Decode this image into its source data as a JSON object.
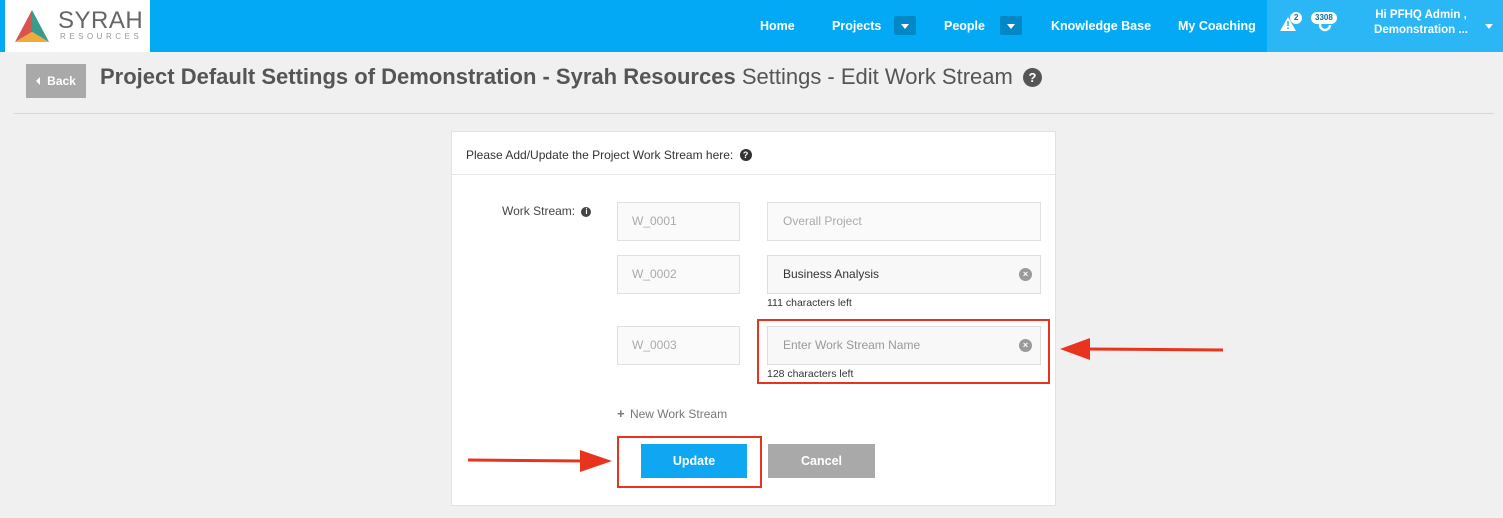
{
  "brand": {
    "name": "SYRAH",
    "sub": "RESOURCES"
  },
  "nav": {
    "home": "Home",
    "projects": "Projects",
    "people": "People",
    "knowledge_base": "Knowledge Base",
    "my_coaching": "My Coaching"
  },
  "notifications": {
    "alerts_count": "2",
    "updates_count": "3308"
  },
  "user": {
    "greeting": "Hi PFHQ Admin ,",
    "org": "Demonstration ..."
  },
  "header": {
    "back_label": "Back",
    "title_bold": "Project Default Settings of Demonstration - Syrah Resources",
    "title_rest": "Settings - Edit Work Stream",
    "help_glyph": "?"
  },
  "form": {
    "heading": "Please Add/Update the Project Work Stream here:",
    "help_glyph": "?",
    "field_label": "Work Stream:",
    "info_glyph": "i",
    "rows": [
      {
        "code": "W_0001",
        "name": "Overall Project"
      },
      {
        "code": "W_0002",
        "name": "Business Analysis",
        "chars_left": "111 characters left"
      },
      {
        "code": "W_0003",
        "name": "",
        "placeholder": "Enter Work Stream Name",
        "chars_left": "128 characters left"
      }
    ],
    "clear_glyph": "×",
    "add_label": "New Work Stream",
    "add_glyph": "+",
    "update_label": "Update",
    "cancel_label": "Cancel"
  },
  "colors": {
    "topbar": "#03a9f4",
    "primary_button": "#0fa6f2",
    "secondary_button": "#a9a9a9",
    "annotation": "#e8341c"
  }
}
